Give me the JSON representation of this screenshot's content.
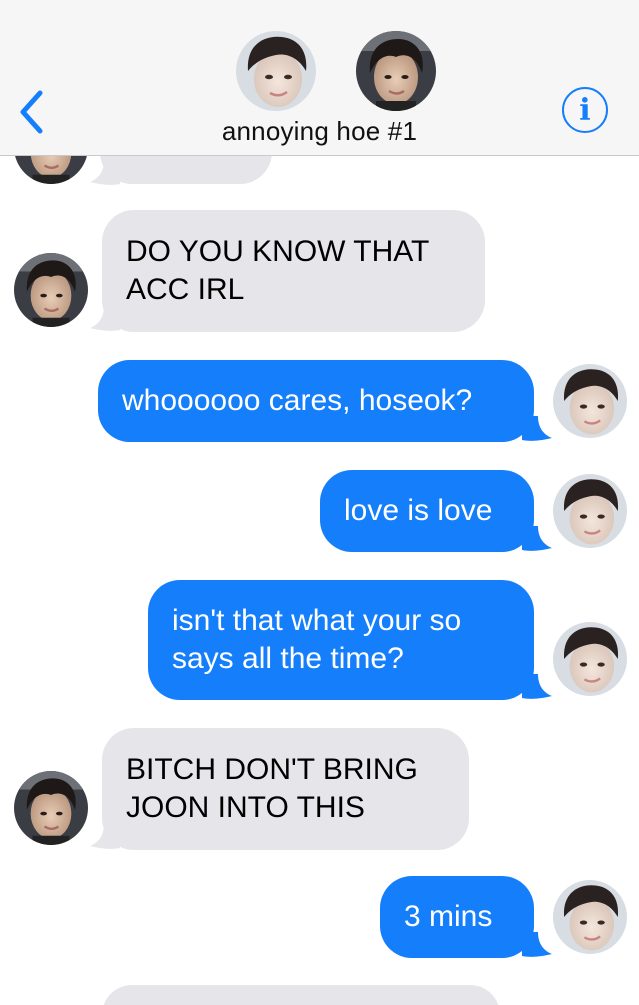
{
  "header": {
    "contact_name": "annoying hoe #1",
    "back_icon": "chevron-left-icon",
    "info_icon": "info-icon",
    "info_glyph": "i"
  },
  "colors": {
    "accent": "#157efb",
    "incoming_bubble": "#e5e5ea",
    "header_bg": "#f6f6f7"
  },
  "messages": [
    {
      "direction": "incoming",
      "lines": [
        "DO YOU KNOW THAT",
        "ACC IRL"
      ]
    },
    {
      "direction": "outgoing",
      "lines": [
        "whoooooo cares, hoseok?"
      ]
    },
    {
      "direction": "outgoing",
      "lines": [
        "love is love"
      ]
    },
    {
      "direction": "outgoing",
      "lines": [
        "isn't that what your so",
        "says all the time?"
      ]
    },
    {
      "direction": "incoming",
      "lines": [
        "BITCH DON'T BRING",
        "JOON INTO THIS"
      ]
    },
    {
      "direction": "outgoing",
      "lines": [
        "3 mins"
      ]
    }
  ]
}
